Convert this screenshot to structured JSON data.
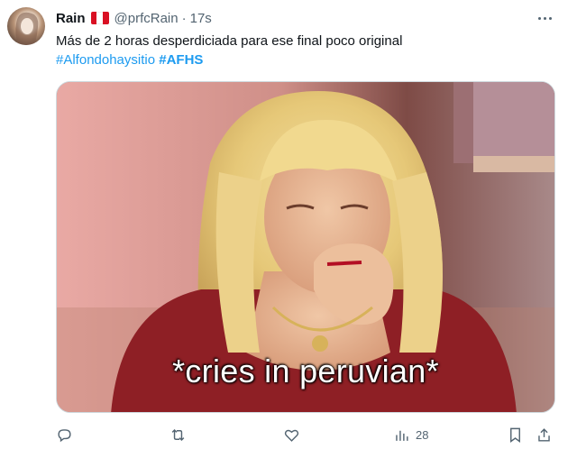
{
  "tweet": {
    "name": "Rain",
    "flag": "flag-peru",
    "handle": "@prfcRain",
    "separator": "·",
    "time": "17s",
    "text": "Más de 2 horas desperdiciada para ese final poco original",
    "hashtags": [
      "#Alfondohaysitio",
      "#AFHS"
    ],
    "media": {
      "caption": "*cries in peruvian*"
    },
    "actions": {
      "views": "28"
    }
  },
  "colors": {
    "link": "#1d9bf0",
    "secondary_text": "#536471",
    "peru_red": "#d91023"
  }
}
